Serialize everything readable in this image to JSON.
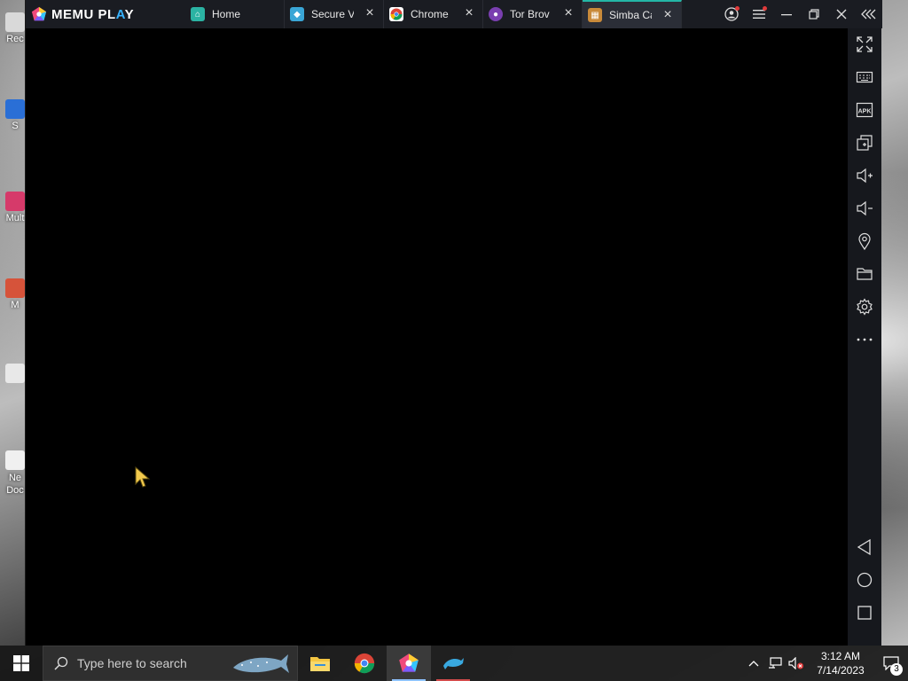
{
  "desktop": {
    "icons": [
      {
        "label": "Rec",
        "color": "#d9d9d9"
      },
      {
        "label": "S",
        "color": "#2a6fd6"
      },
      {
        "label": "Mult",
        "color": "#d63a6a"
      },
      {
        "label": "M",
        "color": "#d6533a"
      },
      {
        "label": "",
        "color": "#e8e8e8"
      },
      {
        "label": "Ne Doc",
        "color": "#f0f0f0"
      }
    ]
  },
  "emulator": {
    "brand": {
      "prefix": "MEMU PL",
      "accent": "A",
      "suffix": "Y"
    },
    "tabs": [
      {
        "label": "Home",
        "icon": "home-app-icon",
        "color": "#2bb3a3",
        "closable": false
      },
      {
        "label": "Secure V",
        "icon": "secure-vpn-icon",
        "color": "#3aa6d6",
        "closable": true
      },
      {
        "label": "Chrome",
        "icon": "chrome-icon",
        "color": "#ffffff",
        "closable": true
      },
      {
        "label": "Tor Brov",
        "icon": "tor-browser-icon",
        "color": "#7a3fb0",
        "closable": true
      },
      {
        "label": "Simba Ca",
        "icon": "simba-cat-icon",
        "color": "#c98a3a",
        "closable": true,
        "active": true
      }
    ],
    "window_controls": [
      "account-icon",
      "menu-icon",
      "minimize-icon",
      "restore-icon",
      "close-icon",
      "collapse-sidebar-icon"
    ],
    "sidebar": [
      "fullscreen-icon",
      "keyboard-icon",
      "apk-icon",
      "multi-instance-icon",
      "volume-up-icon",
      "volume-down-icon",
      "location-icon",
      "folder-icon",
      "settings-icon",
      "more-icon",
      "back-icon",
      "home-icon",
      "recents-icon"
    ],
    "sidebar_apk_text": "APK"
  },
  "taskbar": {
    "search_placeholder": "Type here to search",
    "apps": [
      "file-explorer-icon",
      "chrome-icon",
      "memu-icon",
      "dolphin-icon"
    ],
    "time": "3:12 AM",
    "date": "7/14/2023",
    "notification_count": "3"
  },
  "colors": {
    "accent": "#24b6a6",
    "titlebar": "#1a1c22",
    "sidebar": "#16181d"
  }
}
